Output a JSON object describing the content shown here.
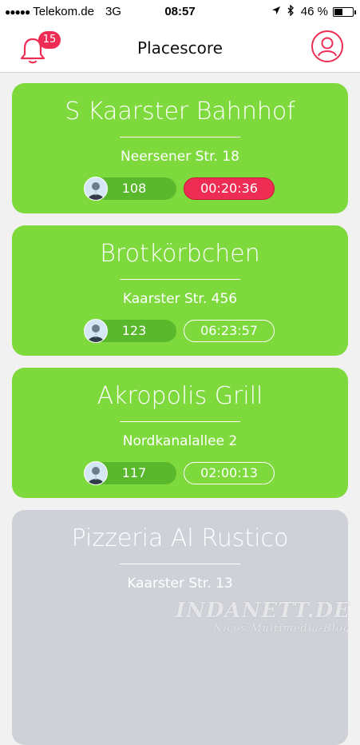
{
  "status_bar": {
    "carrier": "Telekom.de",
    "network": "3G",
    "time": "08:57",
    "battery_percent": "46 %",
    "battery_level": 0.46,
    "icons": [
      "signal-dots-icon",
      "location-arrow-icon",
      "bluetooth-icon",
      "battery-icon"
    ]
  },
  "nav": {
    "title": "Placescore",
    "notification_count": "15",
    "accent_color": "#ef2c54"
  },
  "places": [
    {
      "name": "S Kaarster Bahnhof",
      "address": "Neersener Str. 18",
      "score": "108",
      "timer": "00:20:36",
      "timer_state": "urgent",
      "state": "active"
    },
    {
      "name": "Brotkörbchen",
      "address": "Kaarster Str. 456",
      "score": "123",
      "timer": "06:23:57",
      "timer_state": "normal",
      "state": "active"
    },
    {
      "name": "Akropolis Grill",
      "address": "Nordkanalallee 2",
      "score": "117",
      "timer": "02:00:13",
      "timer_state": "normal",
      "state": "active"
    },
    {
      "name": "Pizzeria Al Rustico",
      "address": "Kaarster Str. 13",
      "state": "inactive"
    }
  ],
  "colors": {
    "active_card": "#7ed93d",
    "inactive_card": "#cfd1d8",
    "urgent_timer": "#ef2c54"
  },
  "watermark": {
    "line1": "INDANETT.DE",
    "line2": "Nicos Multimedia-Blog"
  }
}
